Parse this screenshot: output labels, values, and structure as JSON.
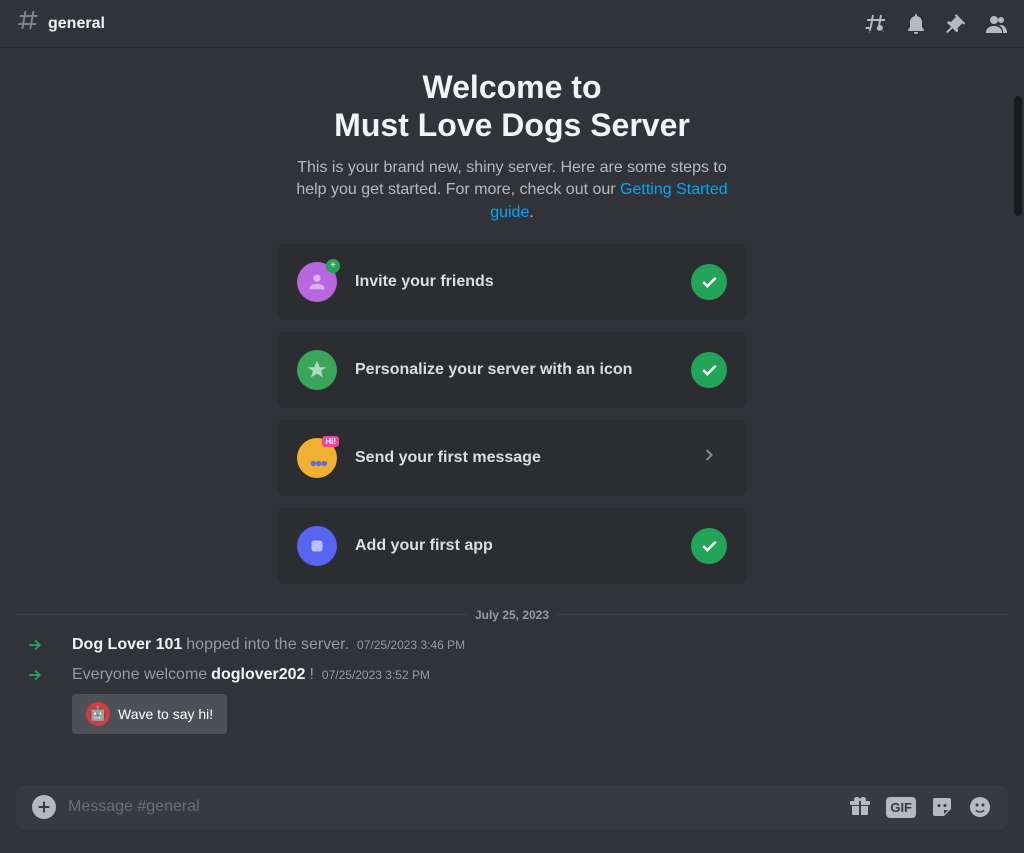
{
  "header": {
    "channel_name": "general"
  },
  "welcome": {
    "title_line1": "Welcome to",
    "title_line2": "Must Love Dogs Server",
    "subtitle_part1": "This is your brand new, shiny server. Here are some steps to help you get started. For more, check out our ",
    "subtitle_link": "Getting Started guide",
    "subtitle_part2": ".",
    "cards": [
      {
        "label": "Invite your friends",
        "done": true
      },
      {
        "label": "Personalize your server with an icon",
        "done": true
      },
      {
        "label": "Send your first message",
        "done": false
      },
      {
        "label": "Add your first app",
        "done": true
      }
    ]
  },
  "divider": {
    "date": "July 25, 2023"
  },
  "messages": [
    {
      "username": "Dog Lover 101",
      "action_text": " hopped into the server.",
      "timestamp": "07/25/2023 3:46 PM"
    },
    {
      "prefix_text": "Everyone welcome ",
      "username": "doglover202",
      "suffix_text": "!",
      "timestamp": "07/25/2023 3:52 PM"
    }
  ],
  "wave_button": {
    "label": "Wave to say hi!"
  },
  "input": {
    "placeholder": "Message #general"
  }
}
